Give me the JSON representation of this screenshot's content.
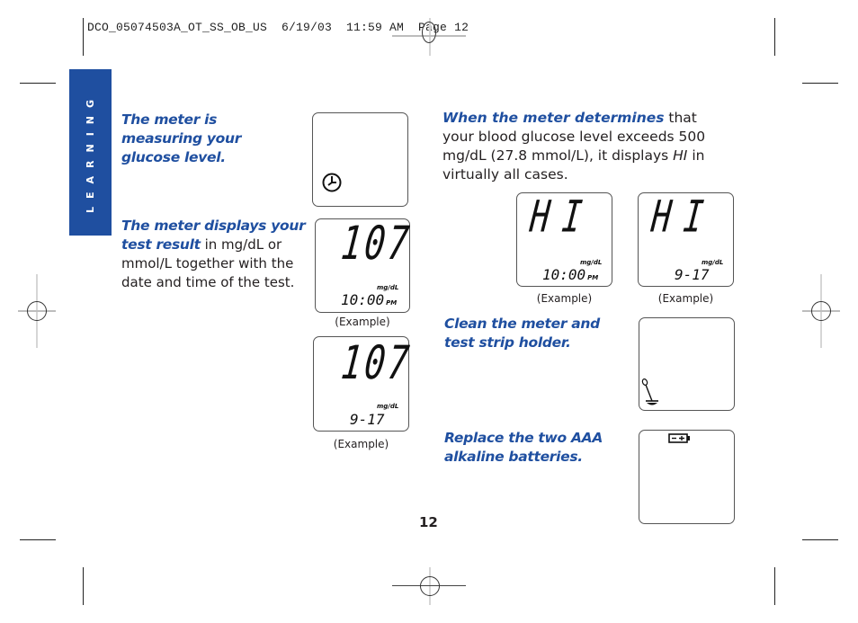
{
  "slug": {
    "text": "DCO_05074503A_OT_SS_OB_US  6/19/03  11:59 AM  Page 12"
  },
  "side_tab": {
    "label": "LEARNING",
    "color": "#1f4fa0"
  },
  "left_column": {
    "measuring": {
      "heading": "The meter is measuring your glucose level."
    },
    "result": {
      "heading": "The meter displays your test result",
      "body": " in mg/dL or mmol/L together with the date and time of the test."
    }
  },
  "displays": {
    "measuring": {
      "icon": "clock-icon"
    },
    "result_time": {
      "value": "107",
      "unit": "mg/dL",
      "time": "10:00",
      "ampm": "PM",
      "caption": "(Example)"
    },
    "result_date": {
      "value": "107",
      "unit": "mg/dL",
      "date": "9-17",
      "caption": "(Example)"
    },
    "hi_time": {
      "value": "HI",
      "unit": "mg/dL",
      "time": "10:00",
      "ampm": "PM",
      "caption": "(Example)"
    },
    "hi_date": {
      "value": "HI",
      "unit": "mg/dL",
      "date": "9-17",
      "caption": "(Example)"
    },
    "clean": {
      "icon": "swab-icon"
    },
    "battery": {
      "icon": "battery-icon"
    }
  },
  "right_column": {
    "hi": {
      "heading": "When the meter determines",
      "body_1": " that your blood glucose level exceeds 500 mg/dL (27.8 mmol/L), it displays ",
      "hi_italic": "HI",
      "body_2": " in virtually all cases."
    },
    "clean": {
      "heading": "Clean the meter and test strip holder."
    },
    "battery": {
      "heading": "Replace the two AAA alkaline batteries."
    }
  },
  "page_number": "12"
}
